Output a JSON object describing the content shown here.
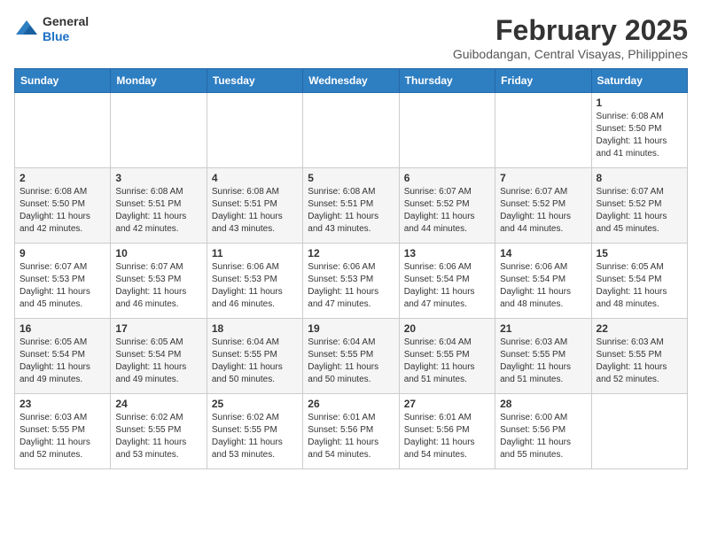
{
  "header": {
    "logo": {
      "line1": "General",
      "line2": "Blue"
    },
    "title": "February 2025",
    "location": "Guibodangan, Central Visayas, Philippines"
  },
  "weekdays": [
    "Sunday",
    "Monday",
    "Tuesday",
    "Wednesday",
    "Thursday",
    "Friday",
    "Saturday"
  ],
  "weeks": [
    [
      {
        "day": "",
        "info": ""
      },
      {
        "day": "",
        "info": ""
      },
      {
        "day": "",
        "info": ""
      },
      {
        "day": "",
        "info": ""
      },
      {
        "day": "",
        "info": ""
      },
      {
        "day": "",
        "info": ""
      },
      {
        "day": "1",
        "info": "Sunrise: 6:08 AM\nSunset: 5:50 PM\nDaylight: 11 hours\nand 41 minutes."
      }
    ],
    [
      {
        "day": "2",
        "info": "Sunrise: 6:08 AM\nSunset: 5:50 PM\nDaylight: 11 hours\nand 42 minutes."
      },
      {
        "day": "3",
        "info": "Sunrise: 6:08 AM\nSunset: 5:51 PM\nDaylight: 11 hours\nand 42 minutes."
      },
      {
        "day": "4",
        "info": "Sunrise: 6:08 AM\nSunset: 5:51 PM\nDaylight: 11 hours\nand 43 minutes."
      },
      {
        "day": "5",
        "info": "Sunrise: 6:08 AM\nSunset: 5:51 PM\nDaylight: 11 hours\nand 43 minutes."
      },
      {
        "day": "6",
        "info": "Sunrise: 6:07 AM\nSunset: 5:52 PM\nDaylight: 11 hours\nand 44 minutes."
      },
      {
        "day": "7",
        "info": "Sunrise: 6:07 AM\nSunset: 5:52 PM\nDaylight: 11 hours\nand 44 minutes."
      },
      {
        "day": "8",
        "info": "Sunrise: 6:07 AM\nSunset: 5:52 PM\nDaylight: 11 hours\nand 45 minutes."
      }
    ],
    [
      {
        "day": "9",
        "info": "Sunrise: 6:07 AM\nSunset: 5:53 PM\nDaylight: 11 hours\nand 45 minutes."
      },
      {
        "day": "10",
        "info": "Sunrise: 6:07 AM\nSunset: 5:53 PM\nDaylight: 11 hours\nand 46 minutes."
      },
      {
        "day": "11",
        "info": "Sunrise: 6:06 AM\nSunset: 5:53 PM\nDaylight: 11 hours\nand 46 minutes."
      },
      {
        "day": "12",
        "info": "Sunrise: 6:06 AM\nSunset: 5:53 PM\nDaylight: 11 hours\nand 47 minutes."
      },
      {
        "day": "13",
        "info": "Sunrise: 6:06 AM\nSunset: 5:54 PM\nDaylight: 11 hours\nand 47 minutes."
      },
      {
        "day": "14",
        "info": "Sunrise: 6:06 AM\nSunset: 5:54 PM\nDaylight: 11 hours\nand 48 minutes."
      },
      {
        "day": "15",
        "info": "Sunrise: 6:05 AM\nSunset: 5:54 PM\nDaylight: 11 hours\nand 48 minutes."
      }
    ],
    [
      {
        "day": "16",
        "info": "Sunrise: 6:05 AM\nSunset: 5:54 PM\nDaylight: 11 hours\nand 49 minutes."
      },
      {
        "day": "17",
        "info": "Sunrise: 6:05 AM\nSunset: 5:54 PM\nDaylight: 11 hours\nand 49 minutes."
      },
      {
        "day": "18",
        "info": "Sunrise: 6:04 AM\nSunset: 5:55 PM\nDaylight: 11 hours\nand 50 minutes."
      },
      {
        "day": "19",
        "info": "Sunrise: 6:04 AM\nSunset: 5:55 PM\nDaylight: 11 hours\nand 50 minutes."
      },
      {
        "day": "20",
        "info": "Sunrise: 6:04 AM\nSunset: 5:55 PM\nDaylight: 11 hours\nand 51 minutes."
      },
      {
        "day": "21",
        "info": "Sunrise: 6:03 AM\nSunset: 5:55 PM\nDaylight: 11 hours\nand 51 minutes."
      },
      {
        "day": "22",
        "info": "Sunrise: 6:03 AM\nSunset: 5:55 PM\nDaylight: 11 hours\nand 52 minutes."
      }
    ],
    [
      {
        "day": "23",
        "info": "Sunrise: 6:03 AM\nSunset: 5:55 PM\nDaylight: 11 hours\nand 52 minutes."
      },
      {
        "day": "24",
        "info": "Sunrise: 6:02 AM\nSunset: 5:55 PM\nDaylight: 11 hours\nand 53 minutes."
      },
      {
        "day": "25",
        "info": "Sunrise: 6:02 AM\nSunset: 5:55 PM\nDaylight: 11 hours\nand 53 minutes."
      },
      {
        "day": "26",
        "info": "Sunrise: 6:01 AM\nSunset: 5:56 PM\nDaylight: 11 hours\nand 54 minutes."
      },
      {
        "day": "27",
        "info": "Sunrise: 6:01 AM\nSunset: 5:56 PM\nDaylight: 11 hours\nand 54 minutes."
      },
      {
        "day": "28",
        "info": "Sunrise: 6:00 AM\nSunset: 5:56 PM\nDaylight: 11 hours\nand 55 minutes."
      },
      {
        "day": "",
        "info": ""
      }
    ]
  ]
}
